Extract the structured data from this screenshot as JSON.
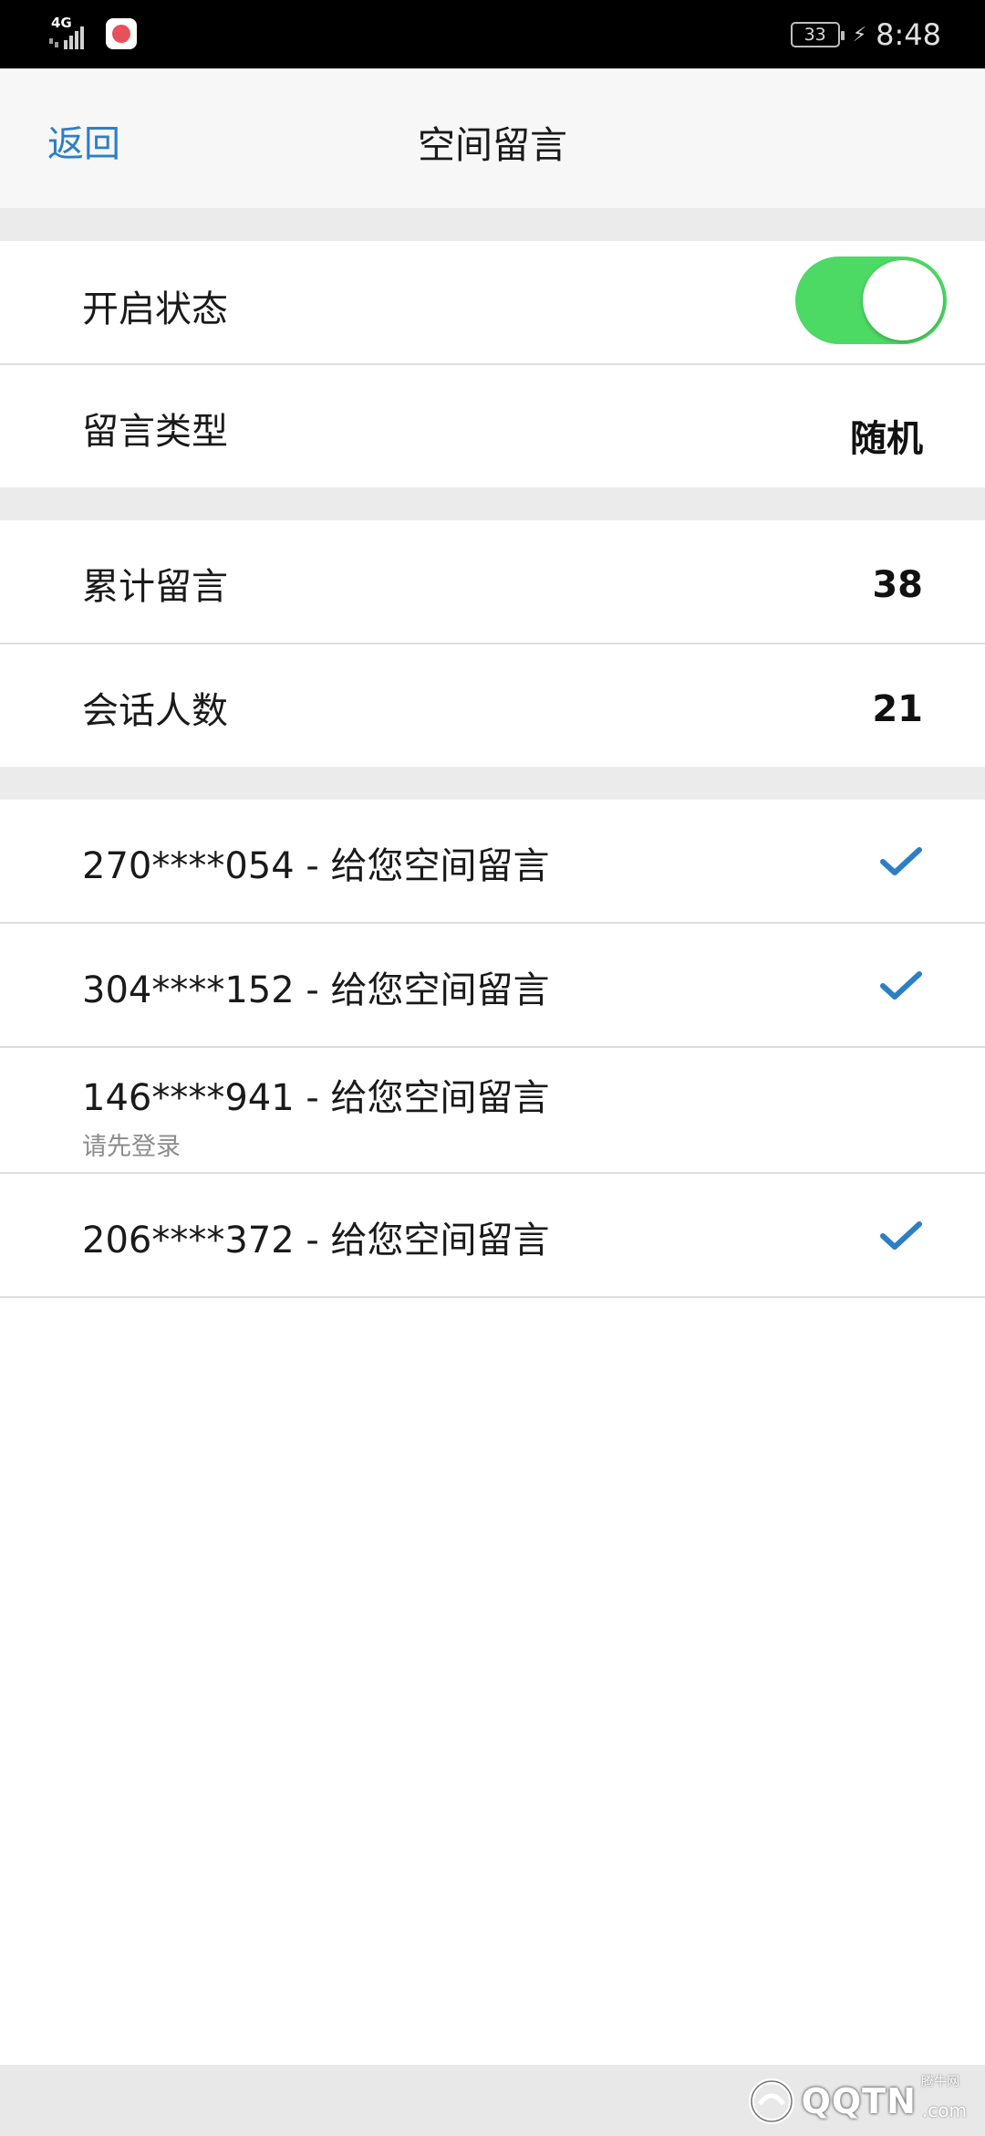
{
  "status_bar": {
    "network": "4G",
    "battery": "33",
    "time": "8:48"
  },
  "nav": {
    "back_label": "返回",
    "title": "空间留言"
  },
  "settings": {
    "enabled_label": "开启状态",
    "enabled": true,
    "type_label": "留言类型",
    "type_value": "随机"
  },
  "stats": {
    "total_label": "累计留言",
    "total_value": "38",
    "sessions_label": "会话人数",
    "sessions_value": "21"
  },
  "messages": [
    {
      "text": "270****054 - 给您空间留言",
      "checked": true,
      "note": ""
    },
    {
      "text": "304****152 - 给您空间留言",
      "checked": true,
      "note": ""
    },
    {
      "text": "146****941 - 给您空间留言",
      "checked": false,
      "note": "请先登录"
    },
    {
      "text": "206****372 - 给您空间留言",
      "checked": true,
      "note": ""
    }
  ],
  "colors": {
    "accent": "#2d7fc4",
    "toggle_on": "#4cd964",
    "check": "#2d7fc4"
  },
  "watermark": {
    "text": "QQTN",
    "suffix": ".com",
    "small": "腾牛网"
  }
}
